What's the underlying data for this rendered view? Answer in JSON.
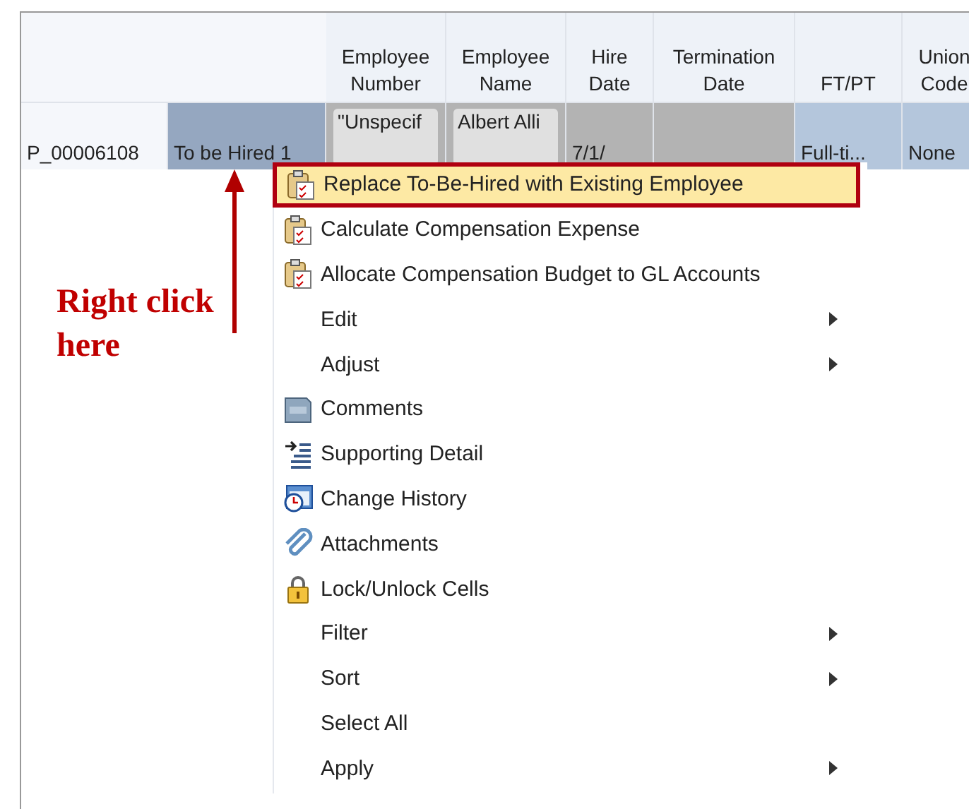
{
  "table": {
    "columns": [
      {},
      {},
      {
        "label": "Employee Number"
      },
      {
        "label": "Employee Name"
      },
      {
        "label": "Hire Date"
      },
      {
        "label": "Termination Date"
      },
      {
        "label": "FT/PT"
      },
      {
        "label": "Union Code"
      }
    ],
    "rows": [
      {
        "cells": [
          {
            "text": "P_00006108",
            "kind": "label"
          },
          {
            "text": "To be Hired 1",
            "kind": "selected-label"
          },
          {
            "text": "\"Unspecif",
            "kind": "input"
          },
          {
            "text": "Albert Alli",
            "kind": "input"
          },
          {
            "text": "7/1/",
            "kind": "grey"
          },
          {
            "kind": "grey"
          },
          {
            "text": "Full-ti...",
            "kind": "blue"
          },
          {
            "text": "None",
            "kind": "blue"
          }
        ]
      }
    ]
  },
  "context_menu": {
    "items": [
      {
        "label": "Replace To-Be-Hired with Existing Employee",
        "kind": "clipboard",
        "submenu": false,
        "selected": true
      },
      {
        "label": "Calculate Compensation Expense",
        "kind": "clipboard",
        "submenu": false,
        "selected": false
      },
      {
        "label": "Allocate Compensation Budget to GL Accounts",
        "kind": "clipboard",
        "submenu": false,
        "selected": false
      },
      {
        "label": "Edit",
        "kind": "plain",
        "submenu": true,
        "selected": false
      },
      {
        "label": "Adjust",
        "kind": "plain",
        "submenu": true,
        "selected": false
      },
      {
        "label": "Comments",
        "kind": "comment",
        "submenu": false,
        "selected": false
      },
      {
        "label": "Supporting Detail",
        "kind": "detail",
        "submenu": false,
        "selected": false
      },
      {
        "label": "Change History",
        "kind": "history",
        "submenu": false,
        "selected": false
      },
      {
        "label": "Attachments",
        "kind": "attach",
        "submenu": false,
        "selected": false
      },
      {
        "label": "Lock/Unlock Cells",
        "kind": "lock",
        "submenu": false,
        "selected": false
      },
      {
        "label": "Filter",
        "kind": "plain",
        "submenu": true,
        "selected": false
      },
      {
        "label": "Sort",
        "kind": "plain",
        "submenu": true,
        "selected": false
      },
      {
        "label": "Select All",
        "kind": "plain",
        "submenu": false,
        "selected": false
      },
      {
        "label": "Apply",
        "kind": "plain",
        "submenu": true,
        "selected": false
      }
    ]
  },
  "annotation": {
    "text": "Right click here"
  }
}
